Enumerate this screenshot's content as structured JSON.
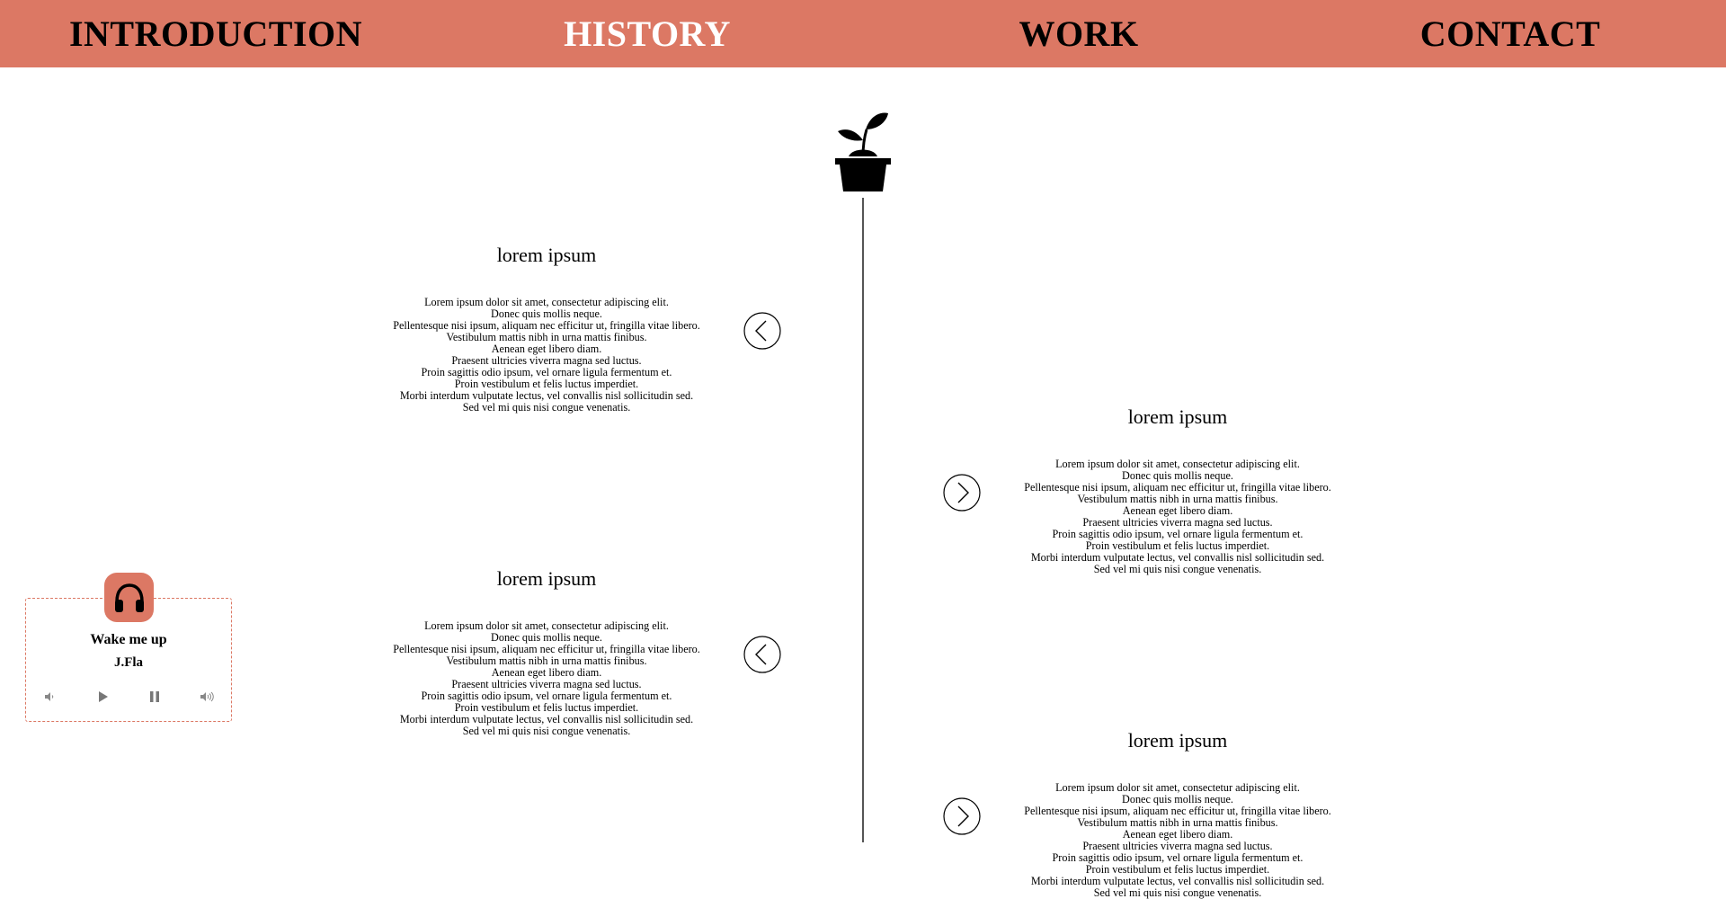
{
  "nav": {
    "items": [
      {
        "label": "INTRODUCTION"
      },
      {
        "label": "HISTORY"
      },
      {
        "label": "WORK"
      },
      {
        "label": "CONTACT"
      }
    ],
    "active_index": 1
  },
  "timeline": {
    "entries": [
      {
        "title": "lorem ipsum",
        "lines": [
          "Lorem ipsum dolor sit amet, consectetur adipiscing elit.",
          "Donec quis mollis neque.",
          "Pellentesque nisi ipsum, aliquam nec efficitur ut, fringilla vitae libero.",
          "Vestibulum mattis nibh in urna mattis finibus.",
          "Aenean eget libero diam.",
          "Praesent ultricies viverra magna sed luctus.",
          "Proin sagittis odio ipsum, vel ornare ligula fermentum et.",
          "Proin vestibulum et felis luctus imperdiet.",
          "Morbi interdum vulputate lectus, vel convallis nisl sollicitudin sed.",
          "Sed vel mi quis nisi congue venenatis."
        ]
      },
      {
        "title": "lorem ipsum",
        "lines": [
          "Lorem ipsum dolor sit amet, consectetur adipiscing elit.",
          "Donec quis mollis neque.",
          "Pellentesque nisi ipsum, aliquam nec efficitur ut, fringilla vitae libero.",
          "Vestibulum mattis nibh in urna mattis finibus.",
          "Aenean eget libero diam.",
          "Praesent ultricies viverra magna sed luctus.",
          "Proin sagittis odio ipsum, vel ornare ligula fermentum et.",
          "Proin vestibulum et felis luctus imperdiet.",
          "Morbi interdum vulputate lectus, vel convallis nisl sollicitudin sed.",
          "Sed vel mi quis nisi congue venenatis."
        ]
      },
      {
        "title": "lorem ipsum",
        "lines": [
          "Lorem ipsum dolor sit amet, consectetur adipiscing elit.",
          "Donec quis mollis neque.",
          "Pellentesque nisi ipsum, aliquam nec efficitur ut, fringilla vitae libero.",
          "Vestibulum mattis nibh in urna mattis finibus.",
          "Aenean eget libero diam.",
          "Praesent ultricies viverra magna sed luctus.",
          "Proin sagittis odio ipsum, vel ornare ligula fermentum et.",
          "Proin vestibulum et felis luctus imperdiet.",
          "Morbi interdum vulputate lectus, vel convallis nisl sollicitudin sed.",
          "Sed vel mi quis nisi congue venenatis."
        ]
      },
      {
        "title": "lorem ipsum",
        "lines": [
          "Lorem ipsum dolor sit amet, consectetur adipiscing elit.",
          "Donec quis mollis neque.",
          "Pellentesque nisi ipsum, aliquam nec efficitur ut, fringilla vitae libero.",
          "Vestibulum mattis nibh in urna mattis finibus.",
          "Aenean eget libero diam.",
          "Praesent ultricies viverra magna sed luctus.",
          "Proin sagittis odio ipsum, vel ornare ligula fermentum et.",
          "Proin vestibulum et felis luctus imperdiet.",
          "Morbi interdum vulputate lectus, vel convallis nisl sollicitudin sed.",
          "Sed vel mi quis nisi congue venenatis."
        ]
      }
    ]
  },
  "player": {
    "icon": "headphones-icon",
    "track_title": "Wake me up",
    "artist": "J.Fla",
    "controls": [
      "volume-down-icon",
      "play-icon",
      "pause-icon",
      "volume-up-icon"
    ]
  },
  "colors": {
    "accent": "#dc7864",
    "active_nav_text": "#ffffff",
    "text": "#000000"
  }
}
